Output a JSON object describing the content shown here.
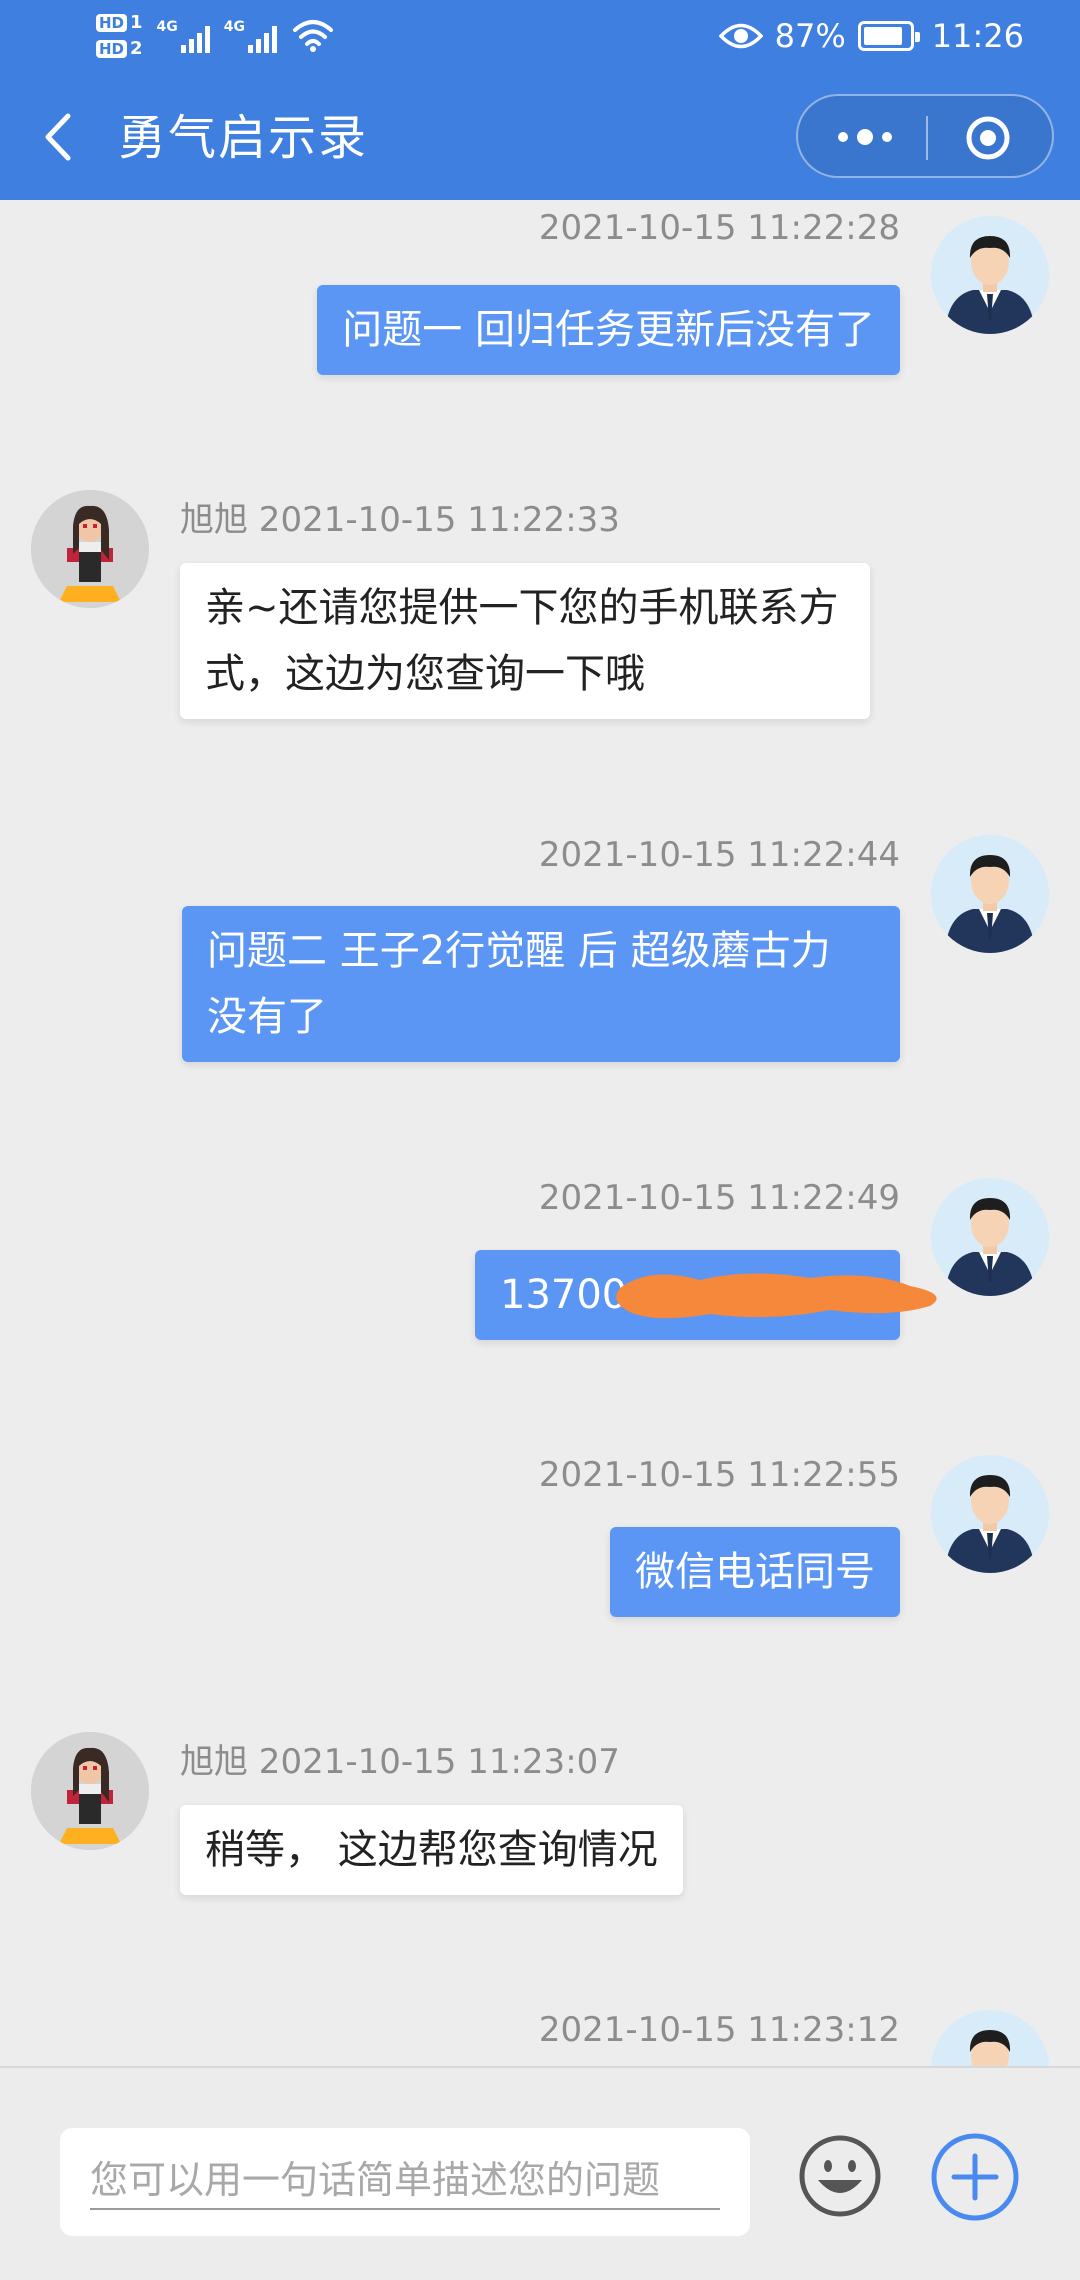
{
  "status_bar": {
    "sim1": "1",
    "sim2": "2",
    "hd": "HD",
    "network": "4G",
    "battery": "87%",
    "time": "11:26",
    "battery_level": 0.87
  },
  "nav": {
    "title": "勇气启示录"
  },
  "messages": [
    {
      "side": "out",
      "meta": "2021-10-15 11:22:28",
      "text": "问题一 回归任务更新后没有了"
    },
    {
      "side": "in",
      "meta": "旭旭 2021-10-15 11:22:33",
      "line1": "亲~还请您提供一下您的手机联系方",
      "line2": "式，这边为您查询一下哦"
    },
    {
      "side": "out",
      "meta": "2021-10-15 11:22:44",
      "line1": "问题二 王子2行觉醒 后 超级蘑古力",
      "line2": "没有了"
    },
    {
      "side": "out",
      "meta": "2021-10-15 11:22:49",
      "text": "13700"
    },
    {
      "side": "out",
      "meta": "2021-10-15 11:22:55",
      "text": "微信电话同号"
    },
    {
      "side": "in",
      "meta": "旭旭 2021-10-15 11:23:07",
      "text": "稍等， 这边帮您查询情况"
    },
    {
      "side": "out",
      "meta": "2021-10-15 11:23:12"
    }
  ],
  "input": {
    "placeholder": "您可以用一句话简单描述您的问题"
  },
  "icons": {
    "back": "chevron-left-icon",
    "more": "more-dots-icon",
    "close": "target-close-icon",
    "emoji": "smiley-face-icon",
    "add": "plus-circle-icon"
  },
  "colors": {
    "header": "#3f7fe0",
    "outgoing_bubble": "#5b96f4",
    "incoming_bubble": "#ffffff",
    "background": "#ededed",
    "redaction": "#f5883a"
  }
}
